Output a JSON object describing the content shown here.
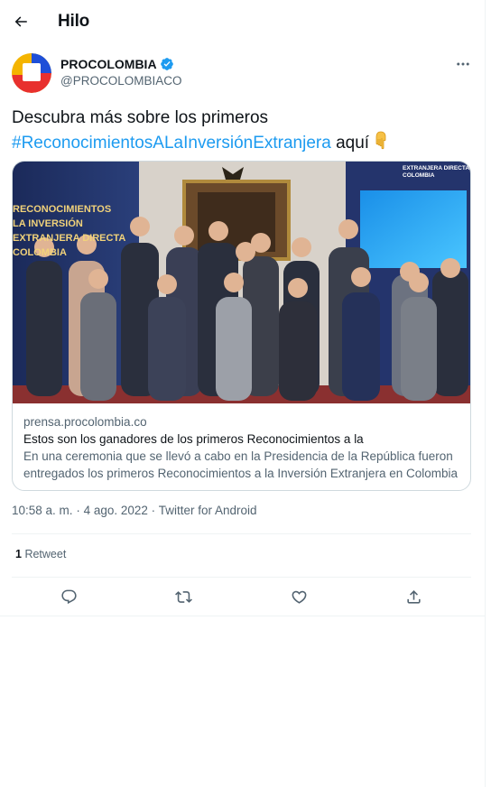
{
  "header": {
    "title": "Hilo"
  },
  "author": {
    "name": "PROCOLOMBIA",
    "handle": "@PROCOLOMBIACO",
    "verified": true
  },
  "tweet": {
    "text_before": "Descubra más sobre los primeros",
    "hashtag": "#ReconocimientosALaInversiónExtranjera",
    "text_after": "aquí"
  },
  "card": {
    "domain": "prensa.procolombia.co",
    "title": "Estos son los ganadores de los primeros Reconocimientos a la",
    "description": "En una ceremonia que se llevó a cabo en la Presidencia de la República fueron entregados los primeros Reconocimientos a la Inversión Extranjera en Colombia",
    "image_text": {
      "left_lines": [
        "RECONOCIMIENTOS",
        "LA INVERSIÓN",
        "EXTRANJERA DIRECTA",
        "COLOMBIA"
      ],
      "right_lines": [
        "EXTRANJERA DIRECTA",
        "COLOMBIA"
      ]
    }
  },
  "meta": {
    "time": "10:58 a. m.",
    "separator": "·",
    "date": "4 ago. 2022",
    "source": "Twitter for Android"
  },
  "stats": {
    "retweets_count": "1",
    "retweets_label": "Retweet"
  },
  "actions": [
    "reply-icon",
    "retweet-icon",
    "like-icon",
    "share-icon"
  ],
  "colors": {
    "accent": "#1d9bf0",
    "text": "#0f1419",
    "secondary": "#536471",
    "border": "#cfd9de"
  }
}
